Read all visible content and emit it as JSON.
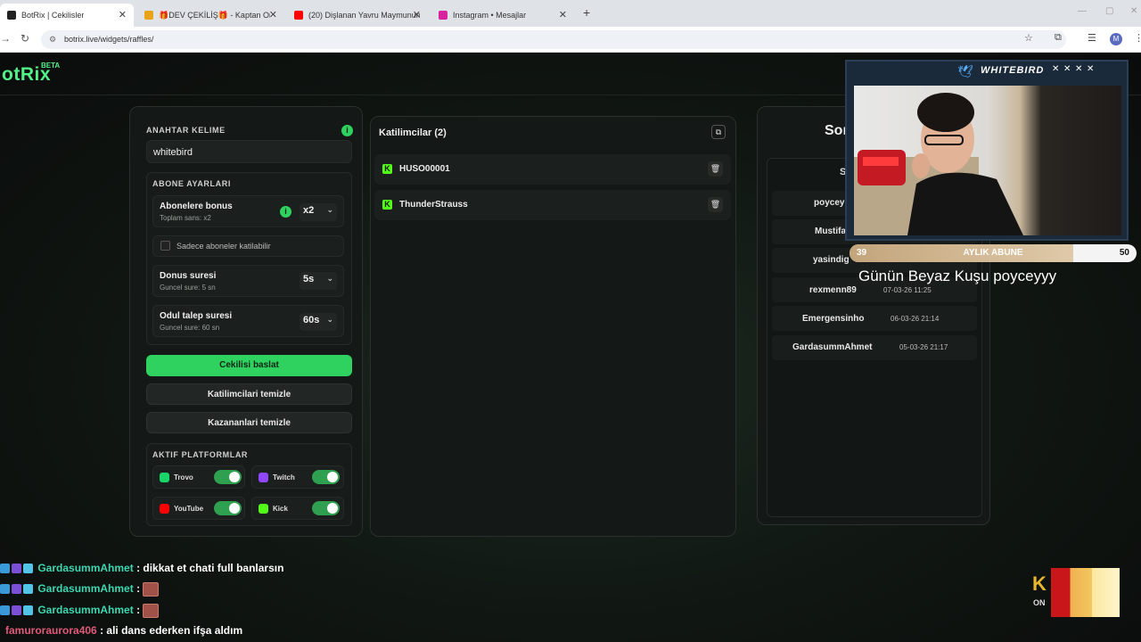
{
  "browser": {
    "tabs": [
      {
        "title": "BotRix | Cekilisler",
        "color": "#222"
      },
      {
        "title": "🎁DEV ÇEKİLİŞ🎁 - Kaptan Or",
        "color": "#e8a317"
      },
      {
        "title": "(20) Dişlanan Yavru Maymunun",
        "color": "#ff0000"
      },
      {
        "title": "Instagram • Mesajlar",
        "color": "#d6249f"
      }
    ],
    "url": "botrix.live/widgets/raffles/",
    "profile_initial": "M"
  },
  "app": {
    "logo": "otRix",
    "beta": "BETA"
  },
  "settings": {
    "keyword_label": "ANAHTAR KELIME",
    "keyword_value": "whitebird",
    "sub_section": "ABONE AYARLARI",
    "bonus_title": "Abonelere bonus",
    "bonus_sub": "Toplam sans: x2",
    "bonus_value": "x2",
    "subs_only": "Sadece aboneler katilabilir",
    "spin_title": "Donus suresi",
    "spin_sub": "Guncel sure: 5 sn",
    "spin_value": "5s",
    "claim_title": "Odul talep suresi",
    "claim_sub": "Guncel sure: 60 sn",
    "claim_value": "60s",
    "start_btn": "Cekilisi baslat",
    "clear_participants_btn": "Katilimcilari temizle",
    "clear_winners_btn": "Kazananlari temizle",
    "platforms_label": "AKTIF PLATFORMLAR",
    "platforms": [
      {
        "name": "Trovo",
        "color": "#19d66b",
        "enabled": true
      },
      {
        "name": "Twitch",
        "color": "#9146ff",
        "enabled": true
      },
      {
        "name": "YouTube",
        "color": "#ff0000",
        "enabled": true
      },
      {
        "name": "Kick",
        "color": "#53fc18",
        "enabled": true
      }
    ]
  },
  "participants": {
    "title": "Katilimcilar (2)",
    "list": [
      {
        "name": "HUSO00001",
        "platform": "kick"
      },
      {
        "name": "ThunderStrauss",
        "platform": "kick"
      }
    ]
  },
  "winners": {
    "title_partial": "Son",
    "header_partial": "S",
    "list": [
      {
        "name": "poycey",
        "date": ""
      },
      {
        "name": "Mustifa",
        "date": ""
      },
      {
        "name": "yasindig",
        "date": ""
      },
      {
        "name": "rexmenn89",
        "date": "07-03-26 11:25"
      },
      {
        "name": "Emergensinho",
        "date": "06-03-26 21:14"
      },
      {
        "name": "GardasummAhmet",
        "date": "05-03-26 21:17"
      }
    ]
  },
  "stream_overlay": {
    "title": "WHITEBIRD",
    "sub_goal_min": "39",
    "sub_goal_label": "AYLIK ABUNE",
    "sub_goal_max": "50",
    "sub_goal_progress": 0.78,
    "caption": "Günün Beyaz Kuşu poyceyyy"
  },
  "chat": [
    {
      "user": "GardasummAhmet",
      "user_color": "#3ed6b0",
      "message": ": dikkat et chati full banlarsın",
      "emote": false
    },
    {
      "user": "GardasummAhmet",
      "user_color": "#3ed6b0",
      "message": ":",
      "emote": true
    },
    {
      "user": "GardasummAhmet",
      "user_color": "#3ed6b0",
      "message": ":",
      "emote": true
    },
    {
      "user": "famuroraurora406",
      "user_color": "#e05a7a",
      "message": ": ali dans ederken ifşa aldım",
      "emote": false
    }
  ],
  "corner_logo": {
    "letter": "K",
    "sub": "ON"
  }
}
